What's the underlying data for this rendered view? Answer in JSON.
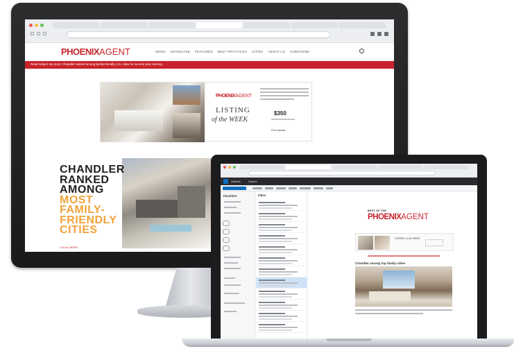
{
  "desktop": {
    "logo": {
      "part1": "PHOENIX",
      "part2": "AGENT"
    },
    "nav": [
      "NEWS",
      "SHOWCASE",
      "FEATURES",
      "BEST PRACTICES",
      "CITIES",
      "ABOUT US",
      "SUBSCRIBE"
    ],
    "banner_text": "Read today's top story: Chandler ranked among family-friendly U.S. cities for second year running",
    "ad": {
      "logo": {
        "part1": "PHOENIX",
        "part2": "AGENT"
      },
      "listing_line1": "LISTING",
      "listing_line2": "of the WEEK",
      "price": "$350",
      "more": "Find details"
    },
    "hero": {
      "lines_dark": [
        "CHANDLER",
        "RANKED",
        "AMONG"
      ],
      "lines_orange": [
        "MOST",
        "FAMILY-",
        "FRIENDLY",
        "CITIES"
      ],
      "link": "LOCAL NEWS"
    }
  },
  "laptop": {
    "app_bar": [
      "Outlook",
      "Search"
    ],
    "folders": {
      "header": "Favorites"
    },
    "list": {
      "header": "Inbox"
    },
    "email": {
      "mini_header": "BEST OF THE",
      "logo": {
        "part1": "PHOENIX",
        "part2": "AGENT"
      },
      "card_text": "LISTING of the WEEK",
      "title": "Chandler among top family cities"
    }
  },
  "colors": {
    "brand_red": "#c8232c",
    "orange": "#f2a23a",
    "outlook_blue": "#0f6cbd"
  }
}
